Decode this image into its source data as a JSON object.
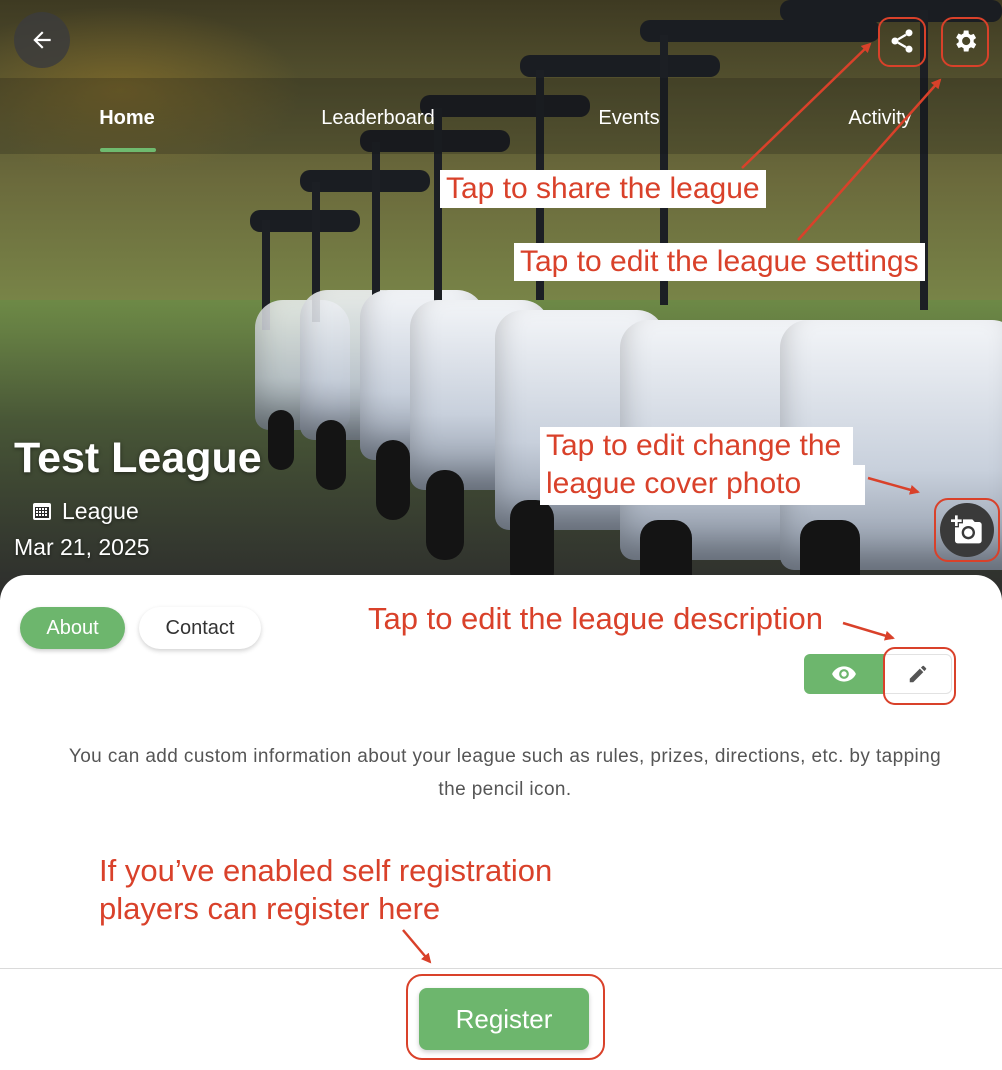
{
  "header": {
    "back_icon": "arrow-left-icon",
    "share_icon": "share-icon",
    "settings_icon": "gear-icon"
  },
  "tabs": [
    {
      "label": "Home",
      "active": true
    },
    {
      "label": "Leaderboard",
      "active": false
    },
    {
      "label": "Events",
      "active": false
    },
    {
      "label": "Activity",
      "active": false
    }
  ],
  "league": {
    "name": "Test League",
    "type_icon": "calendar-icon",
    "type": "League",
    "date": "Mar 21, 2025",
    "cover_photo_icon": "add-photo-icon"
  },
  "details": {
    "tabs": [
      {
        "label": "About",
        "active": true
      },
      {
        "label": "Contact",
        "active": false
      }
    ],
    "view_icon": "eye-icon",
    "edit_icon": "pencil-icon",
    "description": "You can add custom information about your league such as rules, prizes, directions, etc. by tapping the pencil icon."
  },
  "actions": {
    "register_label": "Register"
  },
  "annotations": {
    "share": "Tap to share the league",
    "settings": "Tap to edit the league settings",
    "cover_line1": "Tap to edit change the",
    "cover_line2": "league cover photo",
    "description": "Tap to edit the league description",
    "register_line1": "If you’ve enabled self registration",
    "register_line2": "players can register here"
  },
  "colors": {
    "accent_green": "#6db66d",
    "annotation_red": "#d9412a"
  }
}
